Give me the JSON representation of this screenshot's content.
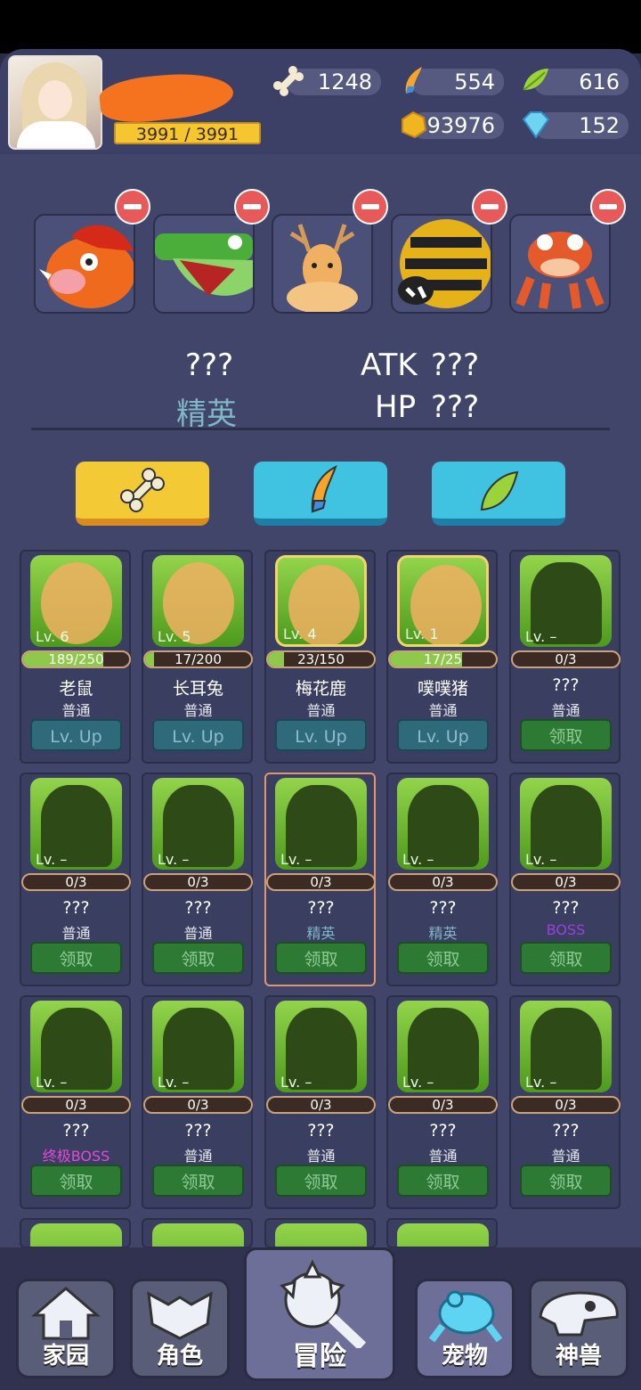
{
  "player": {
    "hp_text": "3991 / 3991"
  },
  "resources": {
    "bone": "1248",
    "feather": "554",
    "leaf": "616",
    "gold": "93976",
    "gem": "152"
  },
  "team": [
    "boar",
    "crocodile",
    "deer",
    "bee",
    "frog"
  ],
  "selected": {
    "name": "???",
    "rank": "精英",
    "atk_label": "ATK",
    "atk": "???",
    "hp_label": "HP",
    "hp": "???"
  },
  "colors": {
    "rank_normal": "#e8e8f0",
    "rank_elite": "#7fb7c6",
    "rank_boss": "#9b3fe0",
    "rank_final_boss": "#e24ad6"
  },
  "cards": [
    {
      "lv": "Lv. 6",
      "progress": "189/250",
      "fill": 0.756,
      "name": "老鼠",
      "rank": "普通",
      "action": "Lv. Up",
      "gold": false,
      "sil": false
    },
    {
      "lv": "Lv. 5",
      "progress": "17/200",
      "fill": 0.085,
      "name": "长耳兔",
      "rank": "普通",
      "action": "Lv. Up",
      "gold": false,
      "sil": false
    },
    {
      "lv": "Lv. 4",
      "progress": "23/150",
      "fill": 0.153,
      "name": "梅花鹿",
      "rank": "普通",
      "action": "Lv. Up",
      "gold": true,
      "sil": false
    },
    {
      "lv": "Lv. 1",
      "progress": "17/25",
      "fill": 0.68,
      "name": "噗噗猪",
      "rank": "普通",
      "action": "Lv. Up",
      "gold": true,
      "sil": false
    },
    {
      "lv": "Lv. –",
      "progress": "0/3",
      "fill": 0,
      "name": "???",
      "rank": "普通",
      "action": "领取",
      "gold": false,
      "sil": true
    },
    {
      "lv": "Lv. –",
      "progress": "0/3",
      "fill": 0,
      "name": "???",
      "rank": "普通",
      "action": "领取",
      "gold": false,
      "sil": true
    },
    {
      "lv": "Lv. –",
      "progress": "0/3",
      "fill": 0,
      "name": "???",
      "rank": "普通",
      "action": "领取",
      "gold": false,
      "sil": true
    },
    {
      "lv": "Lv. –",
      "progress": "0/3",
      "fill": 0,
      "name": "???",
      "rank": "精英",
      "action": "领取",
      "gold": false,
      "sil": true
    },
    {
      "lv": "Lv. –",
      "progress": "0/3",
      "fill": 0,
      "name": "???",
      "rank": "精英",
      "action": "领取",
      "gold": false,
      "sil": true
    },
    {
      "lv": "Lv. –",
      "progress": "0/3",
      "fill": 0,
      "name": "???",
      "rank": "BOSS",
      "action": "领取",
      "gold": false,
      "sil": true
    },
    {
      "lv": "Lv. –",
      "progress": "0/3",
      "fill": 0,
      "name": "???",
      "rank": "终极BOSS",
      "action": "领取",
      "gold": false,
      "sil": true
    },
    {
      "lv": "Lv. –",
      "progress": "0/3",
      "fill": 0,
      "name": "???",
      "rank": "普通",
      "action": "领取",
      "gold": false,
      "sil": true
    },
    {
      "lv": "Lv. –",
      "progress": "0/3",
      "fill": 0,
      "name": "???",
      "rank": "普通",
      "action": "领取",
      "gold": false,
      "sil": true
    },
    {
      "lv": "Lv. –",
      "progress": "0/3",
      "fill": 0,
      "name": "???",
      "rank": "普通",
      "action": "领取",
      "gold": false,
      "sil": true
    },
    {
      "lv": "Lv. –",
      "progress": "0/3",
      "fill": 0,
      "name": "???",
      "rank": "普通",
      "action": "领取",
      "gold": false,
      "sil": true
    }
  ],
  "nav": {
    "home": "家园",
    "role": "角色",
    "adventure": "冒险",
    "pet": "宠物",
    "beast": "神兽"
  }
}
